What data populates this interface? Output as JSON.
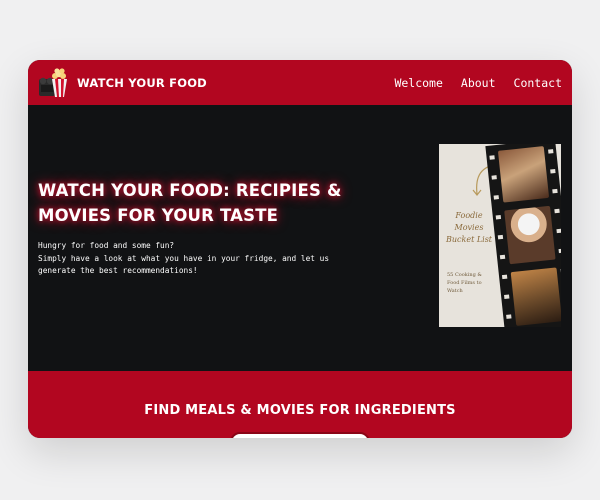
{
  "brand": {
    "name": "WATCH YOUR FOOD",
    "logo_icon": "popcorn-icon"
  },
  "nav": {
    "links": [
      {
        "label": "Welcome"
      },
      {
        "label": "About"
      },
      {
        "label": "Contact"
      }
    ]
  },
  "hero": {
    "title": "WATCH YOUR FOOD: RECIPIES & MOVIES FOR YOUR TASTE",
    "line1": "Hungry for food and some fun?",
    "line2": "Simply have a look at what you have in your fridge, and let us generate the best recommendations!"
  },
  "poster": {
    "title": "Foodie Movies Bucket List",
    "subtitle": "55 Cooking & Food Films to Watch"
  },
  "section": {
    "title": "FIND MEALS & MOVIES FOR INGREDIENTS",
    "search_value": ""
  },
  "colors": {
    "primary": "#b20620",
    "dark": "#111214",
    "background": "#f0f0f1"
  }
}
